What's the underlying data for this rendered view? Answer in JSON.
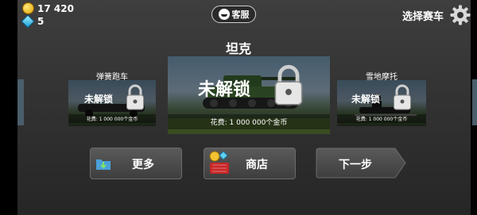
{
  "hud": {
    "coins": "17 420",
    "gems": "5",
    "support_label": "客服",
    "choose_vehicle_label": "选择赛车"
  },
  "selected_vehicle": {
    "name": "坦克",
    "locked_label": "未解锁",
    "cost_label": "花费: 1 000 000个金币"
  },
  "left_vehicle": {
    "name": "弹簧跑车",
    "locked_label": "未解锁",
    "cost_label": "花费: 1 000 000个金币"
  },
  "right_vehicle": {
    "name": "雪地摩托",
    "locked_label": "未解锁",
    "cost_label": "花费: 1 000 000个金币"
  },
  "buttons": {
    "more_label": "更多",
    "shop_label": "商店",
    "next_label": "下一步"
  },
  "icons": [
    "coin-icon",
    "gem-icon",
    "support-face-icon",
    "gear-icon",
    "lock-icon",
    "folder-download-icon",
    "shop-basket-icon"
  ]
}
